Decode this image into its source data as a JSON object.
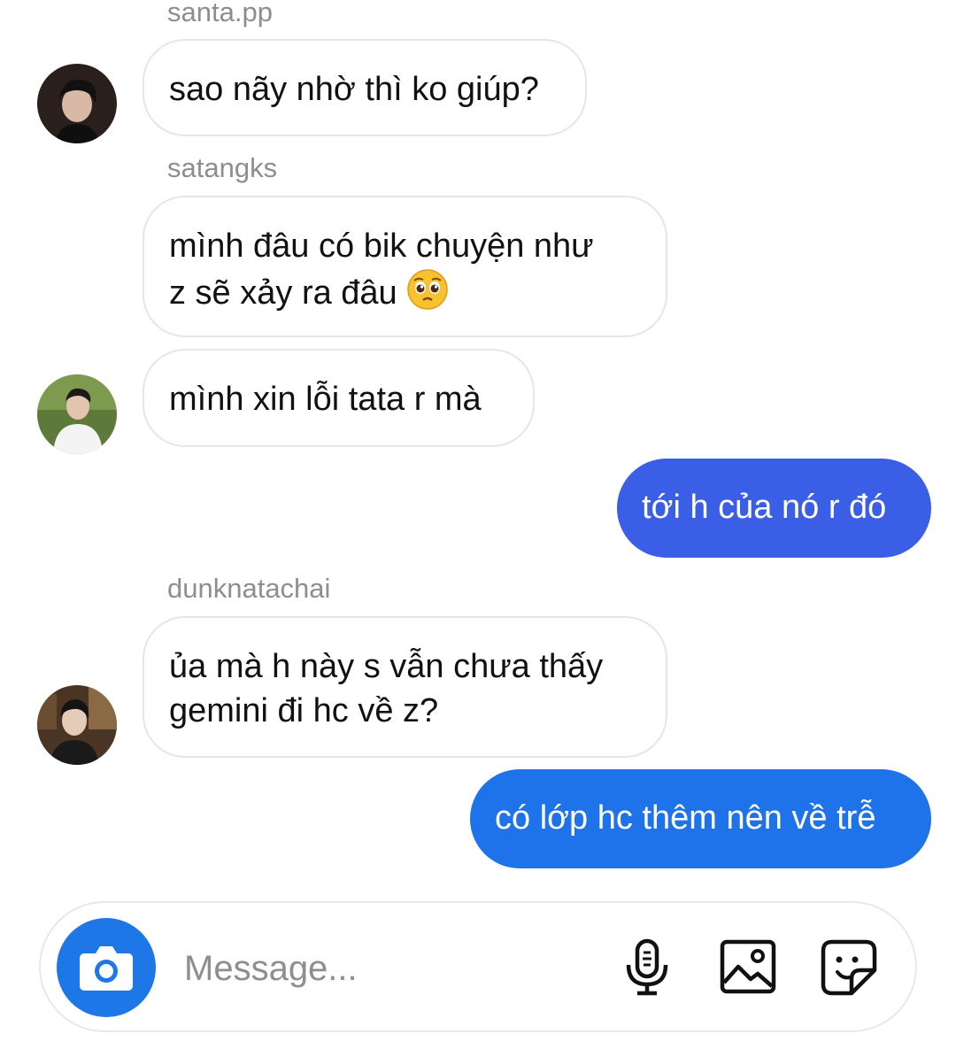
{
  "messages": [
    {
      "sender": "santa.pp",
      "text_lines": [
        "sao nãy nhờ thì ko giúp?"
      ]
    },
    {
      "sender": "satangks",
      "text_lines": [
        "mình đâu có bik chuyện như",
        "z sẽ xảy ra đâu"
      ],
      "emoji": "pleading-face-emoji"
    },
    {
      "sender": "",
      "text_lines": [
        "mình xin lỗi tata r mà"
      ]
    },
    {
      "outgoing": true,
      "text_lines": [
        "tới h của nó r đó"
      ]
    },
    {
      "sender": "dunknatachai",
      "text_lines": [
        "ủa mà h này s vẫn chưa thấy",
        "gemini đi hc về z?"
      ]
    },
    {
      "outgoing": true,
      "text_lines": [
        "có lớp hc thêm nên về trễ"
      ]
    }
  ],
  "composer": {
    "placeholder": "Message...",
    "camera_icon": "camera-icon",
    "mic_icon": "microphone-icon",
    "gallery_icon": "image-icon",
    "sticker_icon": "sticker-icon"
  },
  "colors": {
    "outgoing_bubble": "#3a5ee6",
    "outgoing_bubble_last": "#1e72ea",
    "camera_button": "#1e77e6",
    "sender_name": "#8e8e8e",
    "incoming_border": "#e6e6e6"
  }
}
